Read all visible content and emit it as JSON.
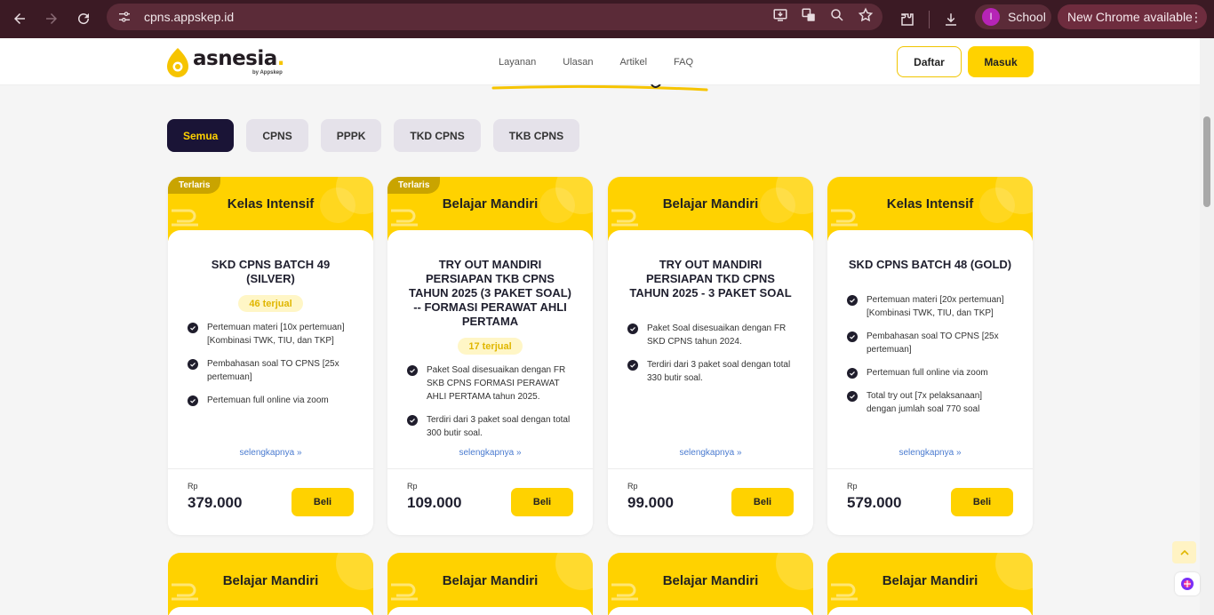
{
  "browser": {
    "url": "cpns.appskep.id",
    "profile_initial": "I",
    "profile_name": "School",
    "update_label": "New Chrome available",
    "colors": {
      "frame": "#3b1a24",
      "omnibox": "#5b2b38"
    }
  },
  "site": {
    "logo_text": "asnesia",
    "logo_dot": ".",
    "logo_sub": "by Appskep",
    "nav": [
      "Layanan",
      "Ulasan",
      "Artikel",
      "FAQ"
    ],
    "register_label": "Daftar",
    "login_label": "Masuk",
    "accent_color": "#ffd200"
  },
  "filters": {
    "tabs": [
      "Semua",
      "CPNS",
      "PPPK",
      "TKD CPNS",
      "TKB CPNS"
    ],
    "active": "Semua"
  },
  "products": [
    {
      "badge": "Terlaris",
      "category": "Kelas Intensif",
      "name": "SKD CPNS BATCH 49 (SILVER)",
      "sold": "46 terjual",
      "features": [
        "Pertemuan materi [10x pertemuan] [Kombinasi TWK, TIU, dan TKP]",
        "Pembahasan soal TO CPNS [25x pertemuan]",
        "Pertemuan full online via zoom"
      ],
      "more": "selengkapnya »",
      "currency": "Rp",
      "price": "379.000",
      "buy": "Beli"
    },
    {
      "badge": "Terlaris",
      "category": "Belajar Mandiri",
      "name": "TRY OUT MANDIRI PERSIAPAN TKB CPNS TAHUN 2025 (3 PAKET SOAL) -- FORMASI PERAWAT AHLI PERTAMA",
      "sold": "17 terjual",
      "features": [
        "Paket Soal disesuaikan dengan FR SKB CPNS FORMASI PERAWAT AHLI PERTAMA tahun 2025.",
        "Terdiri dari 3 paket soal dengan total 300 butir soal."
      ],
      "more": "selengkapnya »",
      "currency": "Rp",
      "price": "109.000",
      "buy": "Beli"
    },
    {
      "badge": "",
      "category": "Belajar Mandiri",
      "name": "TRY OUT MANDIRI PERSIAPAN TKD CPNS TAHUN 2025 - 3 PAKET SOAL",
      "sold": "",
      "features": [
        "Paket Soal disesuaikan dengan FR SKD CPNS tahun 2024.",
        "Terdiri dari 3 paket soal dengan total 330 butir soal."
      ],
      "more": "selengkapnya »",
      "currency": "Rp",
      "price": "99.000",
      "buy": "Beli"
    },
    {
      "badge": "",
      "category": "Kelas Intensif",
      "name": "SKD CPNS BATCH 48 (GOLD)",
      "sold": "",
      "features": [
        "Pertemuan materi [20x pertemuan] [Kombinasi TWK, TIU, dan TKP]",
        "Pembahasan soal TO CPNS [25x pertemuan]",
        "Pertemuan full online via zoom",
        "Total try out [7x pelaksanaan] dengan jumlah soal 770 soal"
      ],
      "more": "selengkapnya »",
      "currency": "Rp",
      "price": "579.000",
      "buy": "Beli"
    }
  ],
  "next_row": [
    "Belajar Mandiri",
    "Belajar Mandiri",
    "Belajar Mandiri",
    "Belajar Mandiri"
  ]
}
